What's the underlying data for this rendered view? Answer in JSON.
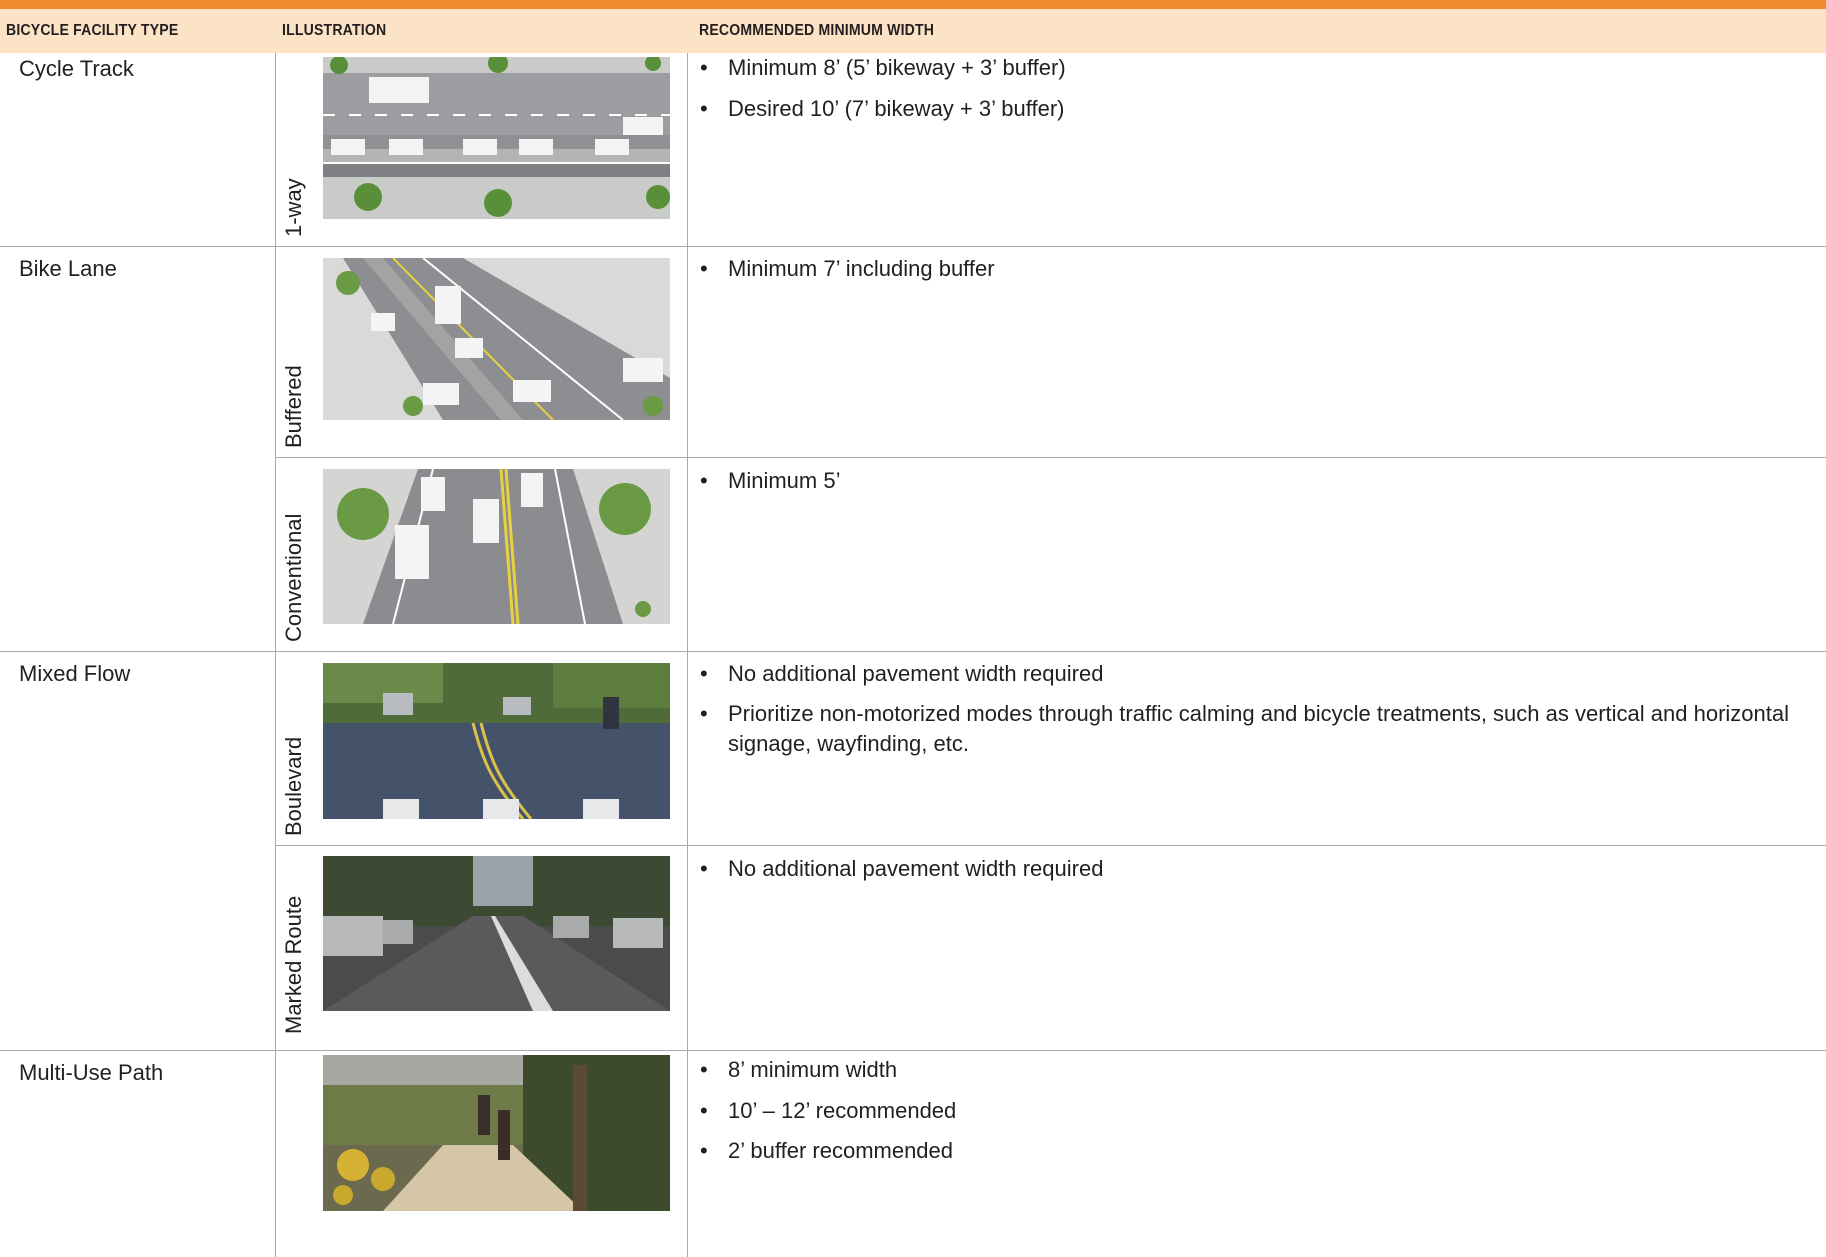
{
  "header": {
    "col1": "BICYCLE FACILITY TYPE",
    "col2": "ILLUSTRATION",
    "col3": "RECOMMENDED MINIMUM WIDTH"
  },
  "rows": [
    {
      "category": "Cycle Track",
      "subtype": "1-way",
      "image": "cycle-track-one-way-plan-view",
      "bullets": [
        "Minimum 8’ (5’ bikeway + 3’ buffer)",
        "Desired 10’ (7’ bikeway + 3’ buffer)"
      ]
    },
    {
      "category": "Bike Lane",
      "subtype": "Buffered",
      "image": "buffered-bike-lane-rendering",
      "bullets": [
        "Minimum 7’ including buffer"
      ]
    },
    {
      "category": "",
      "subtype": "Conventional",
      "image": "conventional-bike-lane-rendering",
      "bullets": [
        "Minimum 5’"
      ]
    },
    {
      "category": "Mixed Flow",
      "subtype": "Boulevard",
      "image": "bike-boulevard-photo",
      "bullets": [
        "No additional pavement width required",
        "Prioritize non-motorized modes through traffic calming and bicycle treatments, such as vertical and horizontal signage, wayfinding, etc."
      ]
    },
    {
      "category": "",
      "subtype": "Marked Route",
      "image": "marked-route-photo",
      "bullets": [
        "No additional pavement width required"
      ]
    },
    {
      "category": "Multi-Use Path",
      "subtype": "",
      "image": "multi-use-path-photo",
      "bullets": [
        "8’ minimum width",
        "10’ – 12’ recommended",
        "2’ buffer recommended"
      ]
    }
  ],
  "bullet_glyph": "•",
  "colors": {
    "accent_bar": "#ef8a2e",
    "header_bg": "#fde3c6",
    "rule": "#a7a9ac"
  }
}
